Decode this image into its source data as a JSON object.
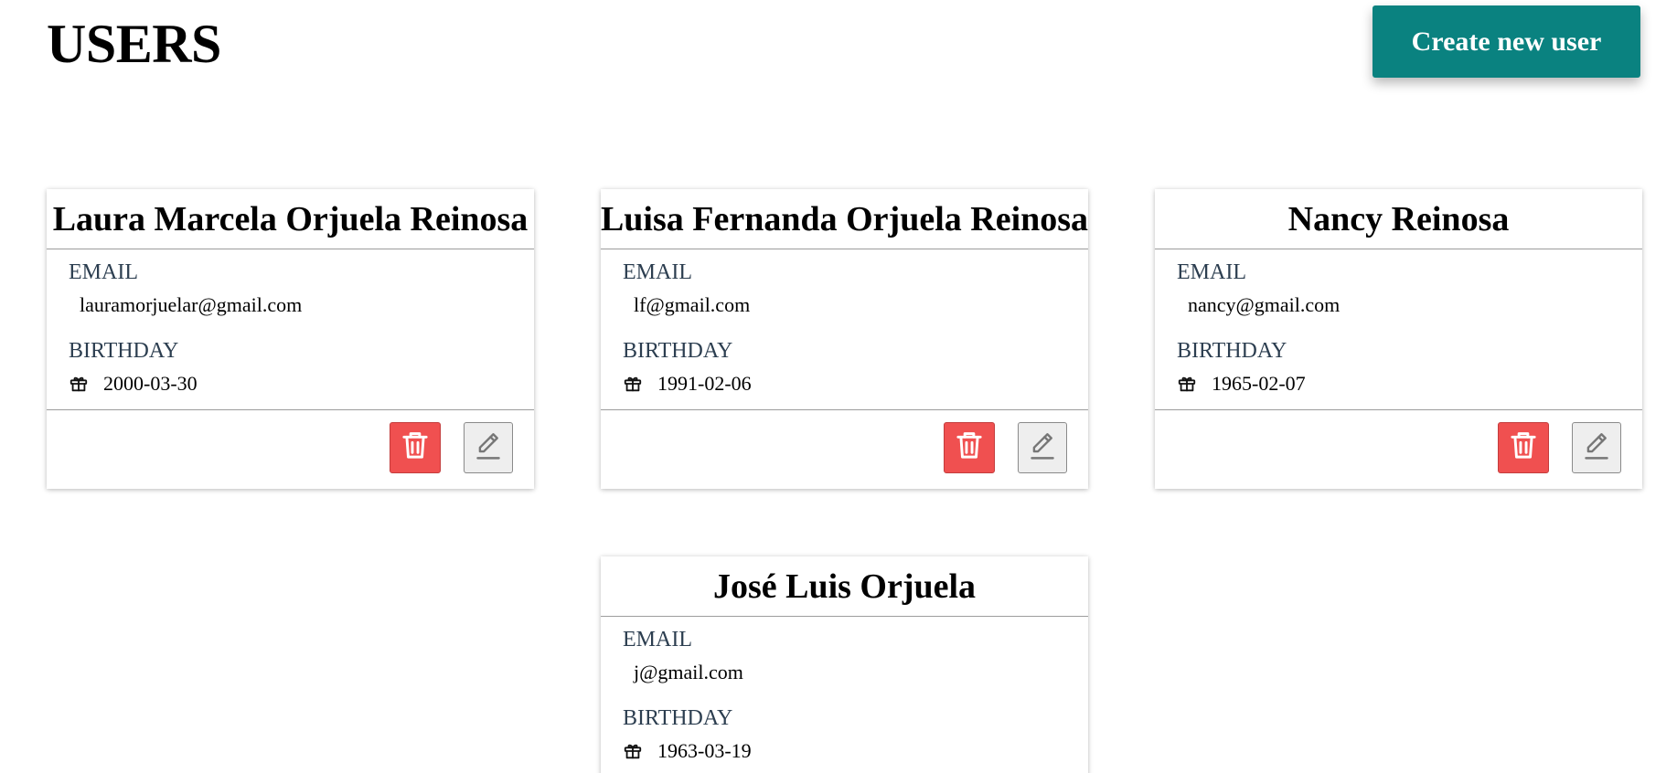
{
  "header": {
    "title": "USERS",
    "create_button_label": "Create new user"
  },
  "labels": {
    "email": "EMAIL",
    "birthday": "BIRTHDAY"
  },
  "icons": {
    "birthday": "gift-icon",
    "delete": "trash-icon",
    "edit": "pencil-icon"
  },
  "colors": {
    "accent": "#0a8280",
    "delete": "#f05050",
    "label": "#2c3e50"
  },
  "users": [
    {
      "name": "Laura Marcela Orjuela Reinosa",
      "email": "lauramorjuelar@gmail.com",
      "birthday": "2000-03-30"
    },
    {
      "name": "Luisa Fernanda Orjuela Reinosa",
      "email": "lf@gmail.com",
      "birthday": "1991-02-06"
    },
    {
      "name": "Nancy Reinosa",
      "email": "nancy@gmail.com",
      "birthday": "1965-02-07"
    },
    {
      "name": "José Luis Orjuela",
      "email": "j@gmail.com",
      "birthday": "1963-03-19"
    }
  ]
}
